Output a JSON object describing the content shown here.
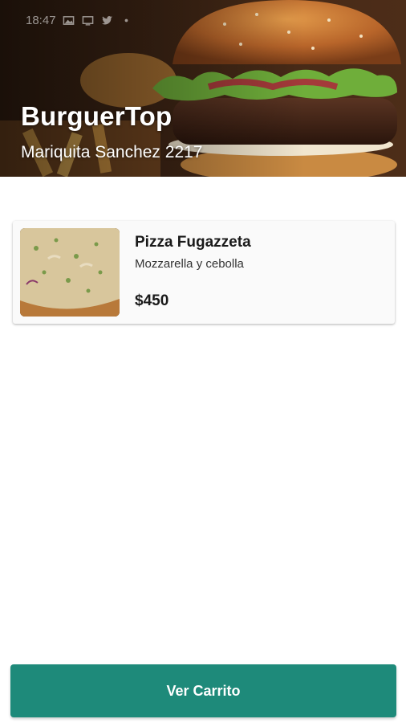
{
  "status_bar": {
    "time": "18:47",
    "icons": [
      "image-icon",
      "cast-icon",
      "twitter-icon",
      "dot-icon"
    ],
    "text_color": "#ffffff"
  },
  "restaurant": {
    "name": "BurguerTop",
    "address": "Mariquita Sanchez 2217"
  },
  "products": [
    {
      "title": "Pizza Fugazzeta",
      "description": "Mozzarella y cebolla",
      "price": "$450"
    }
  ],
  "cart_button": {
    "label": "Ver Carrito",
    "color": "#1e8a7a"
  }
}
